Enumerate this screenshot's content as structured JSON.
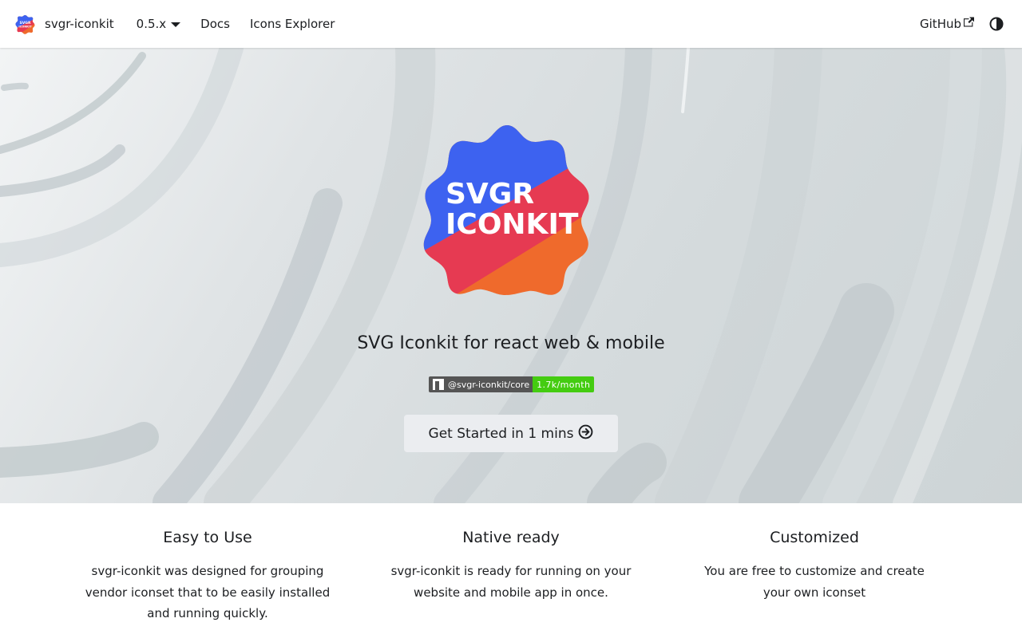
{
  "navbar": {
    "brand_title": "svgr-iconkit",
    "version_label": "0.5.x",
    "docs_label": "Docs",
    "icons_explorer_label": "Icons Explorer",
    "github_label": "GitHub"
  },
  "hero": {
    "logo_text_line1": "SVGR",
    "logo_text_line2": "ICONKIT",
    "tagline": "SVG Iconkit for react web & mobile",
    "badge_label": "@svgr-iconkit/core",
    "badge_value": "1.7k/month",
    "cta_label": "Get Started in 1 mins"
  },
  "features": [
    {
      "title": "Easy to Use",
      "description": "svgr-iconkit was designed for grouping vendor iconset that to be easily installed and running quickly."
    },
    {
      "title": "Native ready",
      "description": "svgr-iconkit is ready for running on your website and mobile app in once."
    },
    {
      "title": "Customized",
      "description": "You are free to customize and create your own iconset"
    }
  ],
  "colors": {
    "logo_blue": "#3d62f0",
    "logo_red": "#e63a52",
    "logo_orange": "#ef6a2c",
    "badge_green": "#44cc11",
    "badge_gray": "#555555",
    "cta_bg": "#ebedf0"
  },
  "icons": {
    "brand": "svgr-iconkit-logo",
    "version_caret": "chevron-down-icon",
    "github_external": "external-link-icon",
    "theme": "half-circle-contrast-icon",
    "cta": "arrow-right-circle-icon",
    "badge": "npm-icon"
  }
}
